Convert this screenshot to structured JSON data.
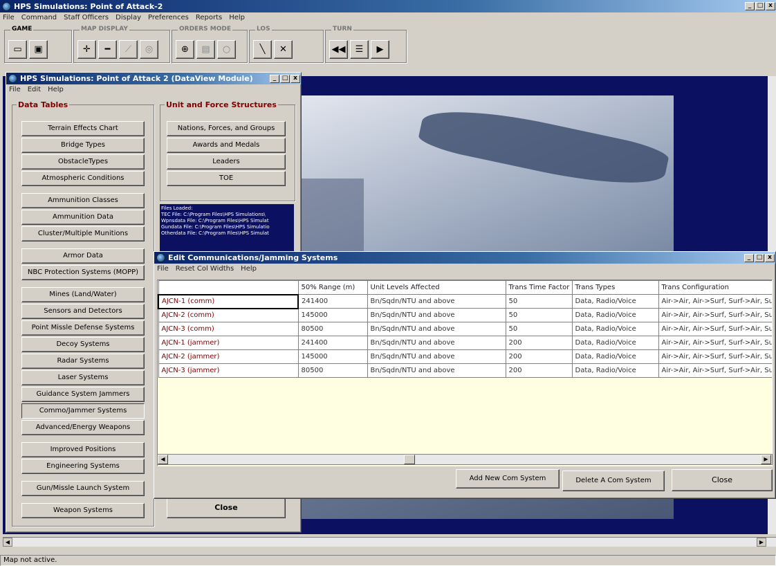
{
  "main_window": {
    "title": "HPS Simulations: Point of Attack-2",
    "menu": [
      "File",
      "Command",
      "Staff Officers",
      "Display",
      "Preferences",
      "Reports",
      "Help"
    ],
    "toolbar_groups": [
      "GAME",
      "MAP DISPLAY",
      "ORDERS MODE",
      "LOS",
      "TURN"
    ],
    "status_text": "Map not active."
  },
  "dataview": {
    "title": "HPS Simulations: Point of Attack 2 (DataView Module)",
    "menu": [
      "File",
      "Edit",
      "Help"
    ],
    "data_tables_label": "Data Tables",
    "data_tables": [
      "Terrain Effects Chart",
      "Bridge Types",
      "ObstacleTypes",
      "Atmospheric Conditions",
      "Ammunition Classes",
      "Ammunition Data",
      "Cluster/Multiple Munitions",
      "Armor Data",
      "NBC Protection Systems (MOPP)",
      "Mines (Land/Water)",
      "Sensors and Detectors",
      "Point Missle Defense Systems",
      "Decoy Systems",
      "Radar Systems",
      "Laser Systems",
      "Guidance System Jammers",
      "Commo/Jammer Systems",
      "Advanced/Energy Weapons",
      "Improved Positions",
      "Engineering Systems",
      "Gun/Missle Launch System",
      "Weapon Systems"
    ],
    "unit_label": "Unit and Force Structures",
    "unit_buttons": [
      "Nations, Forces, and Groups",
      "Awards and Medals",
      "Leaders",
      "TOE"
    ],
    "files_loaded": [
      "Files Loaded:",
      "TEC File: C:\\Program Files\\HPS Simulations\\",
      "Wpnsdata File: C:\\Program Files\\HPS Simulat",
      "Gundata File: C:\\Program Files\\HPS Simulatio",
      "Otherdata File: C:\\Program Files\\HPS Simulat"
    ],
    "close_label": "Close"
  },
  "comm_dialog": {
    "title": "Edit Communications/Jamming Systems",
    "menu": [
      "File",
      "Reset Col Widths",
      "Help"
    ],
    "columns": [
      "",
      "50% Range (m)",
      "Unit Levels Affected",
      "Trans Time Factor",
      "Trans Types",
      "Trans Configuration"
    ],
    "rows": [
      [
        "AJCN-1 (comm)",
        "241400",
        "Bn/Sqdn/NTU and above",
        "50",
        "Data, Radio/Voice",
        "Air->Air, Air->Surf, Surf->Air, Surf->"
      ],
      [
        "AJCN-2 (comm)",
        "145000",
        "Bn/Sqdn/NTU and above",
        "50",
        "Data, Radio/Voice",
        "Air->Air, Air->Surf, Surf->Air, Surf->"
      ],
      [
        "AJCN-3 (comm)",
        "80500",
        "Bn/Sqdn/NTU and above",
        "50",
        "Data, Radio/Voice",
        "Air->Air, Air->Surf, Surf->Air, Surf->"
      ],
      [
        "AJCN-1 (jammer)",
        "241400",
        "Bn/Sqdn/NTU and above",
        "200",
        "Data, Radio/Voice",
        "Air->Air, Air->Surf, Surf->Air, Surf->"
      ],
      [
        "AJCN-2 (jammer)",
        "145000",
        "Bn/Sqdn/NTU and above",
        "200",
        "Data, Radio/Voice",
        "Air->Air, Air->Surf, Surf->Air, Surf->"
      ],
      [
        "AJCN-3 (jammer)",
        "80500",
        "Bn/Sqdn/NTU and above",
        "200",
        "Data, Radio/Voice",
        "Air->Air, Air->Surf, Surf->Air, Surf->"
      ]
    ],
    "add_label": "Add New Com System",
    "delete_label": "Delete A Com System",
    "close_label": "Close"
  },
  "colors": {
    "title_start": "#0a246a",
    "title_end": "#a6caf0",
    "grid_bg": "#ffffe1",
    "map_bg": "#0c1060",
    "row_name": "#800000"
  }
}
